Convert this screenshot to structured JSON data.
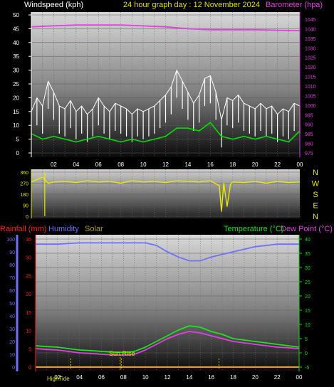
{
  "header": {
    "windspeed": "Windspeed (kph)",
    "title": "24 hour graph day : 12 November 2024",
    "barometer": "Barometer (hpa)"
  },
  "bottom_header": {
    "rainfall": "Rainfall (mm)",
    "humidity": "Humidity",
    "solar": "Solar",
    "temperature": "Temperature (°C)",
    "dewpoint": "Dew Point (°C)"
  },
  "annotations": {
    "sunrise": "Sun Rise",
    "high_tide": "HighTide"
  },
  "colors": {
    "windspeed": "#ffffff",
    "gust": "#ffffff",
    "average": "#00e000",
    "barometer": "#e040e0",
    "title": "#e0e000",
    "wind_dir": "#e8e800",
    "rainfall": "#ff2020",
    "humidity": "#7070ff",
    "solar": "#b0a000",
    "temperature": "#20e020",
    "dewpoint": "#e040e0",
    "rain_line": "#ff9900",
    "right_axis": "#00e000",
    "tide_marker": "#d8d800"
  },
  "chart_data": [
    {
      "type": "line",
      "name": "wind-speed-pressure",
      "x_ticks": [
        "02",
        "04",
        "06",
        "08",
        "10",
        "12",
        "14",
        "16",
        "18",
        "20",
        "22",
        "00"
      ],
      "xlim": [
        0,
        24
      ],
      "y_left": {
        "label": "Windspeed (kph)",
        "ticks": [
          0,
          5,
          10,
          15,
          20,
          25,
          30,
          35,
          40,
          45,
          50
        ],
        "ylim": [
          0,
          50
        ]
      },
      "y_right": {
        "label": "Barometer (hpa)",
        "ticks": [
          975,
          980,
          985,
          990,
          995,
          1000,
          1005,
          1010,
          1015,
          1020,
          1025,
          1030,
          1035,
          1040,
          1045
        ],
        "ylim": [
          975,
          1045
        ]
      },
      "gust_x": [
        0,
        0.5,
        1,
        1.5,
        2,
        2.5,
        3,
        3.5,
        4,
        4.5,
        5,
        5.5,
        6,
        6.5,
        7,
        7.5,
        8,
        8.5,
        9,
        9.5,
        10,
        10.5,
        11,
        11.5,
        12,
        12.5,
        13,
        13.5,
        14,
        14.5,
        15,
        15.5,
        16,
        16.5,
        17,
        17.5,
        18,
        18.5,
        19,
        19.5,
        20,
        20.5,
        21,
        21.5,
        22,
        22.5,
        23,
        23.5,
        24
      ],
      "gust_y": [
        15,
        20,
        17,
        26,
        22,
        17,
        16,
        19,
        15,
        17,
        14,
        16,
        20,
        17,
        15,
        18,
        17,
        16,
        14,
        16,
        15,
        16,
        17,
        19,
        21,
        24,
        30,
        26,
        22,
        18,
        21,
        27,
        28,
        22,
        12,
        20,
        19,
        21,
        18,
        17,
        16,
        18,
        16,
        17,
        14,
        16,
        15,
        18,
        17
      ],
      "avg_x": [
        0,
        1,
        2,
        3,
        4,
        5,
        6,
        7,
        8,
        9,
        10,
        11,
        12,
        13,
        14,
        15,
        16,
        17,
        18,
        19,
        20,
        21,
        22,
        23,
        24
      ],
      "avg_y": [
        7,
        5,
        6,
        5,
        4,
        5,
        6,
        5,
        4,
        5,
        4,
        5,
        6,
        9,
        9,
        8,
        11,
        6,
        5,
        6,
        5,
        6,
        5,
        4,
        8
      ],
      "barometer_x": [
        0,
        2,
        4,
        6,
        8,
        10,
        12,
        14,
        16,
        18,
        20,
        22,
        24
      ],
      "barometer_y": [
        1041,
        1041.5,
        1042,
        1042,
        1042,
        1041.5,
        1041,
        1040,
        1039.5,
        1039.5,
        1039.5,
        1039.2,
        1039
      ]
    },
    {
      "type": "line",
      "name": "wind-direction",
      "xlim": [
        0,
        24
      ],
      "y_ticks": [
        0,
        90,
        180,
        270,
        360
      ],
      "compass": [
        "N",
        "W",
        "S",
        "E",
        "N"
      ],
      "ylim": [
        0,
        360
      ],
      "x": [
        0,
        0.5,
        1,
        1.5,
        2,
        3,
        4,
        5,
        6,
        7,
        8,
        9,
        10,
        11,
        12,
        13,
        14,
        15,
        16,
        16.8,
        17,
        17.2,
        17.5,
        17.8,
        18,
        19,
        20,
        21,
        22,
        23,
        24
      ],
      "y": [
        280,
        300,
        320,
        270,
        280,
        285,
        275,
        290,
        280,
        285,
        270,
        290,
        280,
        285,
        275,
        290,
        285,
        280,
        290,
        250,
        40,
        270,
        80,
        260,
        280,
        275,
        285,
        270,
        285,
        275,
        280
      ]
    },
    {
      "type": "line",
      "name": "temperature-humidity-rain",
      "x_ticks": [
        "02",
        "04",
        "06",
        "08",
        "10",
        "12",
        "14",
        "16",
        "18",
        "20",
        "22",
        "00"
      ],
      "xlim": [
        0,
        24
      ],
      "y_left": {
        "label": "Rainfall (mm)",
        "ticks": [
          0,
          5,
          10,
          15,
          20,
          25,
          30,
          35
        ],
        "ylim": [
          0,
          35
        ]
      },
      "y_humidity": {
        "label": "Humidity",
        "ticks": [
          0,
          10,
          20,
          30,
          40,
          50,
          60,
          70,
          80,
          90,
          100
        ],
        "ylim": [
          0,
          100
        ]
      },
      "y_right": {
        "label": "Temperature (°C)",
        "ticks": [
          -5,
          0,
          5,
          10,
          15,
          20,
          25,
          30,
          35,
          40
        ],
        "ylim": [
          -5,
          40
        ]
      },
      "series": [
        {
          "name": "Humidity",
          "x": [
            0,
            2,
            4,
            6,
            8,
            10,
            11,
            12,
            13,
            14,
            15,
            16,
            17,
            18,
            20,
            22,
            24
          ],
          "y": [
            96,
            96,
            97,
            97,
            97,
            97,
            95,
            90,
            86,
            83,
            83,
            86,
            88,
            90,
            94,
            96,
            96
          ]
        },
        {
          "name": "Temperature (°C)",
          "x": [
            0,
            1,
            2,
            3,
            4,
            5,
            6,
            7,
            8,
            9,
            10,
            11,
            12,
            13,
            14,
            15,
            16,
            17,
            18,
            19,
            20,
            21,
            22,
            23,
            24
          ],
          "y": [
            2.5,
            2.2,
            2,
            1.5,
            1,
            0.8,
            0.5,
            0.3,
            0.2,
            0.5,
            2,
            4,
            6,
            8,
            9.5,
            9,
            7.5,
            6.5,
            5,
            4.5,
            4,
            3.5,
            3,
            2.5,
            2
          ]
        },
        {
          "name": "Dew Point (°C)",
          "x": [
            0,
            1,
            2,
            3,
            4,
            5,
            6,
            7,
            8,
            9,
            10,
            11,
            12,
            13,
            14,
            15,
            16,
            17,
            18,
            19,
            20,
            21,
            22,
            23,
            24
          ],
          "y": [
            1.5,
            1.2,
            1,
            0.5,
            0,
            -0.2,
            -0.5,
            -0.7,
            -0.8,
            -0.5,
            1,
            3,
            5,
            6.5,
            7.5,
            7,
            6,
            5,
            4,
            3.5,
            3,
            2.5,
            2,
            1.8,
            1.5
          ]
        },
        {
          "name": "Rainfall (mm)",
          "x": [
            0,
            24
          ],
          "y": [
            0,
            0
          ]
        }
      ],
      "markers": {
        "sunrise_hour": 7.7,
        "high_tide_hours": [
          3.2,
          7.8,
          16.7
        ]
      }
    }
  ]
}
